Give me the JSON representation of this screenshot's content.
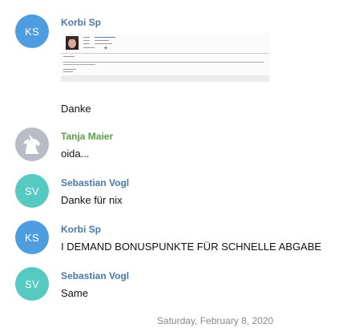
{
  "colors": {
    "ks_avatar": "#4d9de0",
    "sv_avatar": "#56c9c1",
    "tm_avatar": "#b9bcc7",
    "sender_blue": "#4779a8",
    "sender_green": "#5a9e4a"
  },
  "messages": [
    {
      "initials": "KS",
      "sender": "Korbi Sp",
      "attachment_icon": "image-attachment-thumbnail",
      "text": "Danke"
    },
    {
      "avatar_icon": "unicorn-avatar-icon",
      "sender": "Tanja Maier",
      "text": "oida..."
    },
    {
      "initials": "SV",
      "sender": "Sebastian Vogl",
      "text": "Danke für nix"
    },
    {
      "initials": "KS",
      "sender": "Korbi Sp",
      "text": "I DEMAND BONUSPUNKTE FÜR SCHNELLE ABGABE"
    },
    {
      "initials": "SV",
      "sender": "Sebastian Vogl",
      "text": "Same"
    }
  ],
  "date_separator": "Saturday, February 8, 2020"
}
